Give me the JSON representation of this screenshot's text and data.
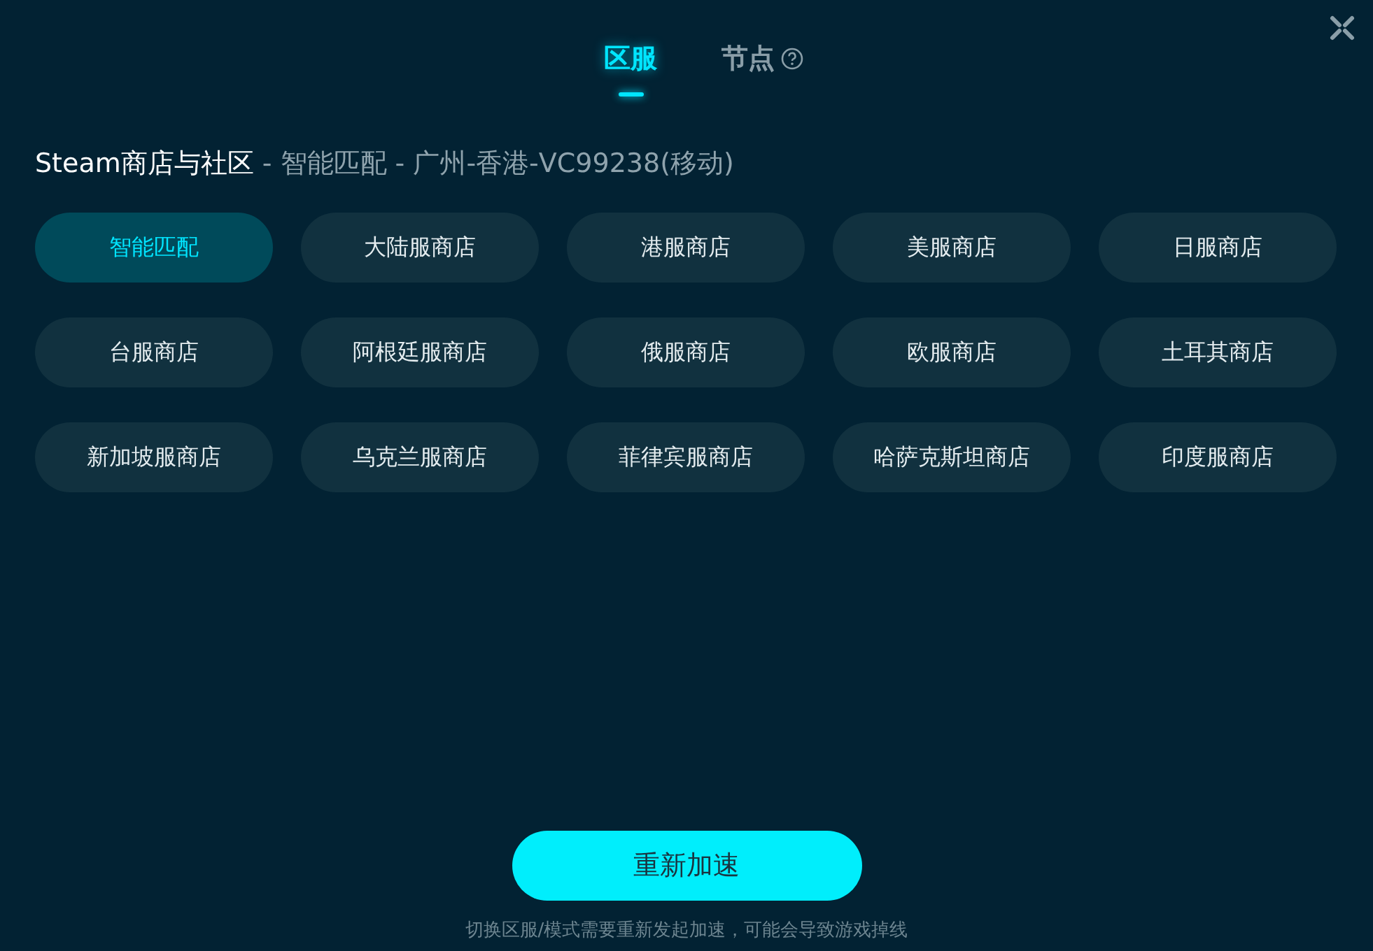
{
  "tabs": [
    {
      "label": "区服",
      "selected": true,
      "help": false
    },
    {
      "label": "节点",
      "selected": false,
      "help": true
    }
  ],
  "title": {
    "service": "Steam商店与社区",
    "detail": "- 智能匹配 - 广州-香港-VC99238(移动)"
  },
  "regions": [
    {
      "label": "智能匹配",
      "selected": true
    },
    {
      "label": "大陆服商店",
      "selected": false
    },
    {
      "label": "港服商店",
      "selected": false
    },
    {
      "label": "美服商店",
      "selected": false
    },
    {
      "label": "日服商店",
      "selected": false
    },
    {
      "label": "台服商店",
      "selected": false
    },
    {
      "label": "阿根廷服商店",
      "selected": false
    },
    {
      "label": "俄服商店",
      "selected": false
    },
    {
      "label": "欧服商店",
      "selected": false
    },
    {
      "label": "土耳其商店",
      "selected": false
    },
    {
      "label": "新加坡服商店",
      "selected": false
    },
    {
      "label": "乌克兰服商店",
      "selected": false
    },
    {
      "label": "菲律宾服商店",
      "selected": false
    },
    {
      "label": "哈萨克斯坦商店",
      "selected": false
    },
    {
      "label": "印度服商店",
      "selected": false
    }
  ],
  "action_button": "重新加速",
  "note": "切换区服/模式需要重新发起加速，可能会导致游戏掉线"
}
